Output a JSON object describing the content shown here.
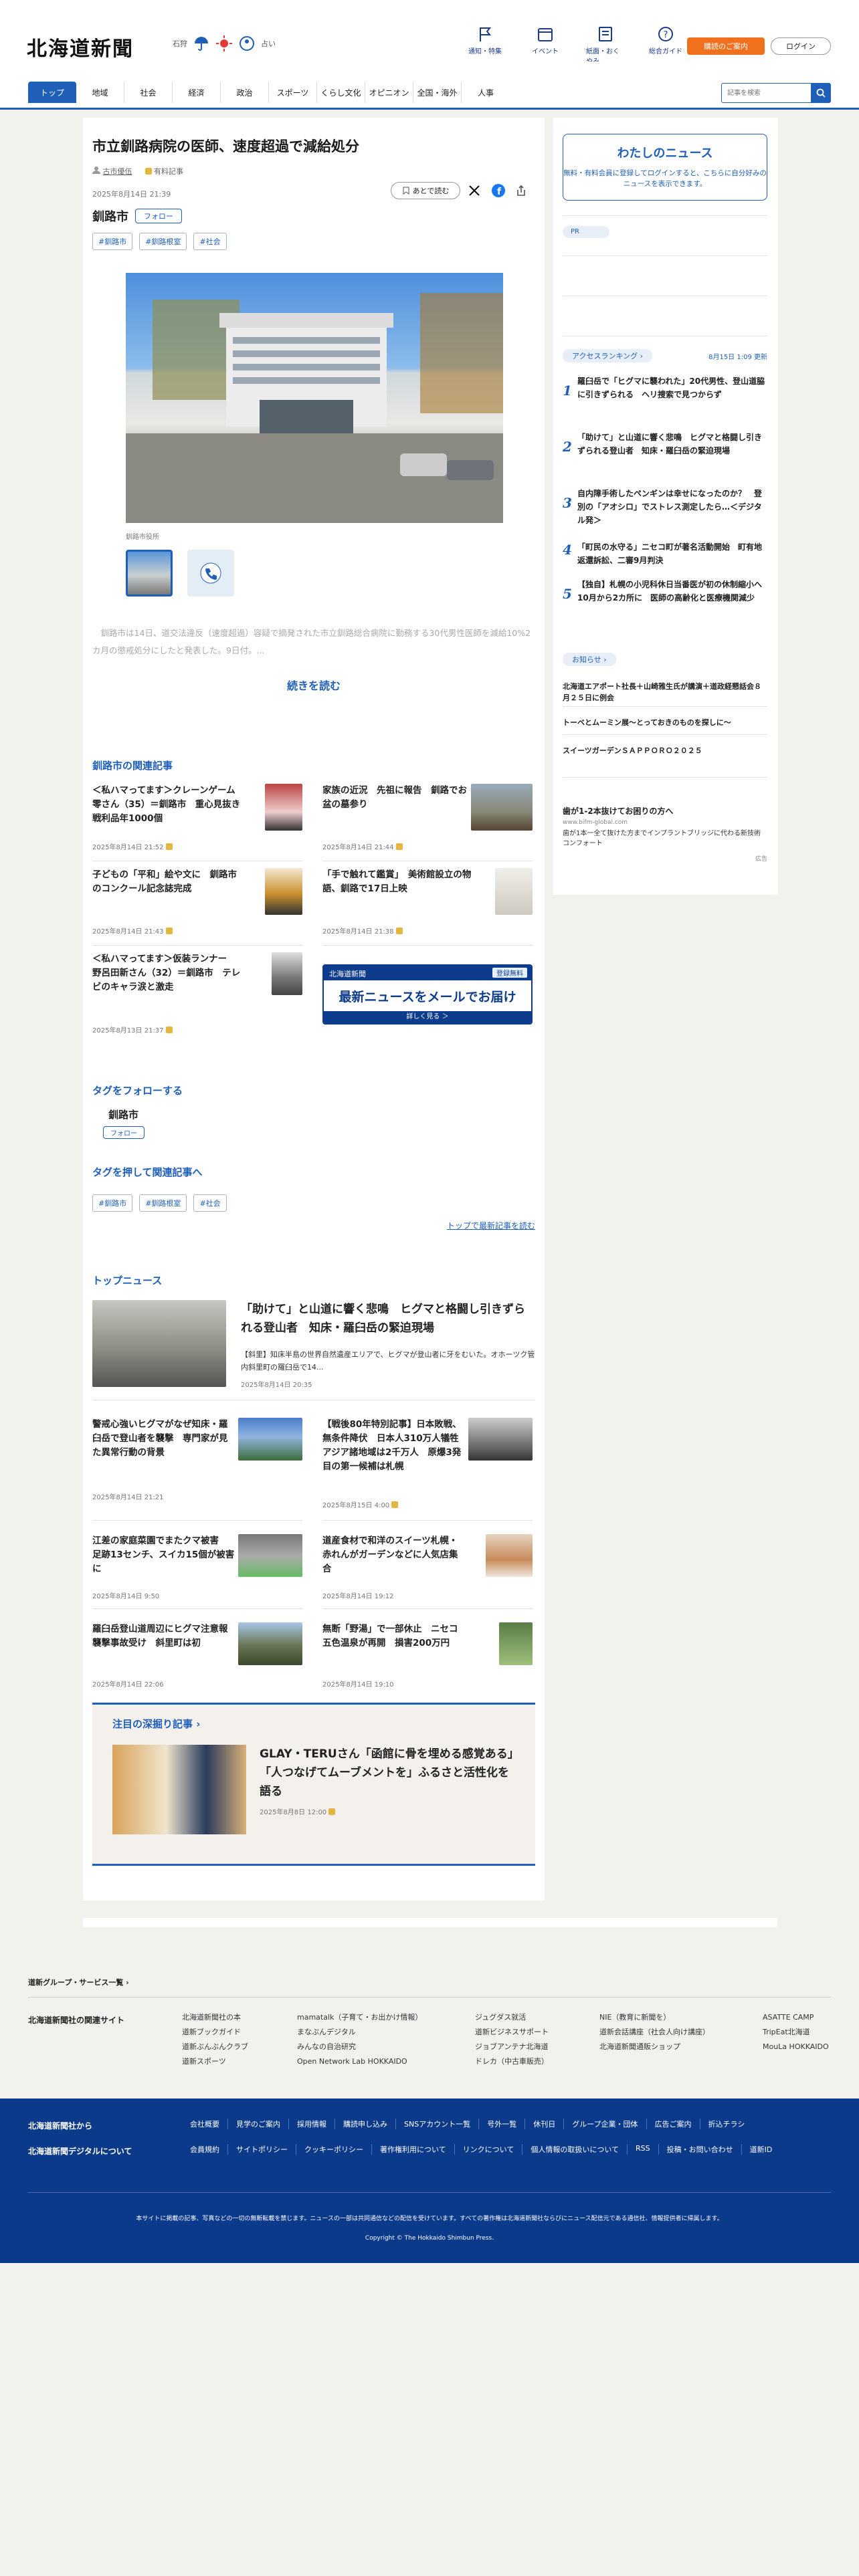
{
  "header": {
    "logo": "北海道新聞",
    "weather_city": "石狩",
    "weather_more": "占い",
    "icons": [
      "通知・特集",
      "イベント",
      "紙面・おくやみ",
      "総合ガイド"
    ],
    "member_button": "購読のご案内",
    "login_button": "ログイン"
  },
  "nav": {
    "items": [
      "トップ",
      "地域",
      "社会",
      "経済",
      "政治",
      "スポーツ",
      "くらし文化",
      "オピニオン",
      "全国・海外",
      "人事"
    ],
    "search_placeholder": "記事を検索"
  },
  "article": {
    "title": "市立釧路病院の医師、速度超過で減給処分",
    "author": "古市優伍",
    "member_badge": "有料記事",
    "datetime": "2025年8月14日 21:39",
    "read_later": "あとで読む",
    "tag_city": "釧路市",
    "follow_label": "フォロー",
    "tags": [
      "#釧路市",
      "#釧路根室",
      "#社会"
    ],
    "photo_caption": "釧路市役所",
    "lead": "　釧路市は14日、道交法違反（速度超過）容疑で摘発された市立釧路総合病院に勤務する30代男性医師を減給10%2カ月の懲戒処分にしたと発表した。9日付。...",
    "read_more": "続きを読む"
  },
  "related": {
    "title": "釧路市の関連記事",
    "items": [
      {
        "title": "＜私ハマってます＞クレーンゲーム　零さん（35）＝釧路市　重心見抜き　戦利品年1000個",
        "date": "2025年8月14日 21:52"
      },
      {
        "title": "家族の近況　先祖に報告　釧路でお盆の墓参り",
        "date": "2025年8月14日 21:44"
      },
      {
        "title": "子どもの「平和」絵や文に　釧路市のコンクール記念誌完成",
        "date": "2025年8月14日 21:43"
      },
      {
        "title": "「手で触れて鑑賞」　美術館設立の物語、釧路で17日上映",
        "date": "2025年8月14日 21:38"
      },
      {
        "title": "＜私ハマってます＞仮装ランナー　野呂田新さん（32）＝釧路市　テレビのキャラ涙と激走",
        "date": "2025年8月13日 21:37"
      }
    ],
    "mail_ad": {
      "brand": "北海道新聞",
      "badge": "登録無料",
      "headline": "最新ニュースをメールでお届け",
      "cta": "詳しく見る ＞"
    }
  },
  "follow_section": {
    "title": "タグをフォローする",
    "city": "釧路市",
    "button": "フォロー"
  },
  "tag_section": {
    "title": "タグを押して関連記事へ",
    "tags": [
      "#釧路市",
      "#釧路根室",
      "#社会"
    ],
    "top_link": "トップで最新記事を読む"
  },
  "top_news": {
    "title": "トップニュース",
    "main": {
      "title": "「助けて」と山道に響く悲鳴　ヒグマと格闘し引きずられる登山者　知床・羅臼岳の緊迫現場",
      "summary": "【斜里】知床半島の世界自然遺産エリアで、ヒグマが登山者に牙をむいた。オホーツク管内斜里町の羅臼岳で14...",
      "date": "2025年8月14日 20:35"
    },
    "items": [
      {
        "title": "警戒心強いヒグマがなぜ知床・羅臼岳で登山者を襲撃　専門家が見た異常行動の背景",
        "date": "2025年8月14日 21:21"
      },
      {
        "title": "【戦後80年特別記事】日本敗戦、無条件降伏　日本人310万人犠牲　アジア諸地域は2千万人　原爆3発目の第一候補は札幌",
        "date": "2025年8月15日 4:00"
      },
      {
        "title": "江差の家庭菜園でまたクマ被害　足跡13センチ、スイカ15個が被害に",
        "date": "2025年8月14日 9:50"
      },
      {
        "title": "道産食材で和洋のスイーツ札幌・赤れんがガーデンなどに人気店集合",
        "date": "2025年8月14日 19:12"
      },
      {
        "title": "羅臼岳登山道周辺にヒグマ注意報　襲撃事故受け　斜里町は初",
        "date": "2025年8月14日 22:06"
      },
      {
        "title": "無断「野湯」で一部休止　ニセコ五色温泉が再開　損害200万円",
        "date": "2025年8月14日 19:10"
      }
    ]
  },
  "feature": {
    "title": "注目の深掘り記事",
    "headline": "GLAY・TERUさん「函館に骨を埋める感覚ある」「人つなげてムーブメントを」ふるさと活性化を語る",
    "date": "2025年8月8日 12:00"
  },
  "sidebar": {
    "mynews_title": "わたしのニュース",
    "mynews_text": "無料・有料会員に登録してログインすると、こちらに自分好みのニュースを表示できます。",
    "pr": "PR",
    "ranking_title": "アクセスランキング",
    "ranking_updated": "8月15日 1:09 更新",
    "ranking": [
      "羅臼岳で「ヒグマに襲われた」20代男性、登山道脇に引きずられる　ヘリ捜索で見つからず",
      "「助けて」と山道に響く悲鳴　ヒグマと格闘し引きずられる登山者　知床・羅臼岳の緊迫現場",
      "自内障手術したペンギンは幸せになったのか？　登別の「アオシロ」でストレス測定したら…＜デジタル発＞",
      "「町民の水守る」ニセコ町が著名活動開始　町有地返還訴訟、二審9月判決",
      "【独自】札幌の小児科休日当番医が初の休制縮小へ　10月から2カ所に　医師の高齢化と医療機関減少"
    ],
    "info_title": "お知らせ",
    "info": [
      "北海道エアポート社長＋山崎雅生氏が講演＋道政経懇話会８月２５日に例会",
      "トーベとムーミン展～とっておきのものを探しに～",
      "スイーツガーデンＳＡＰＰＯＲＯ２０２５"
    ],
    "ad_title": "歯が1-2本抜けてお困りの方へ",
    "ad_url": "www.bifm-global.com",
    "ad_text": "歯が1本一全て抜けた方までインプラントブリッジに代わる新技術コンフォート",
    "ad_label": "広告"
  },
  "footer": {
    "group_link": "道新グループ・サービス一覧",
    "related_title": "北海道新聞社の関連サイト",
    "cols": [
      [
        "北海道新聞社の本",
        "道新ブックガイド",
        "道新ぶんぶんクラブ",
        "道新スポーツ"
      ],
      [
        "mamatalk（子育て・お出かけ情報）",
        "まなぶんデジタル",
        "みんなの自治研究",
        "Open Network Lab HOKKAIDO"
      ],
      [
        "ジュグダス就活",
        "道新ビジネスサポート",
        "ジョブアンテナ北海道",
        "ドレカ（中古車販売）"
      ],
      [
        "NIE（教育に新聞を）",
        "道新会話講座（社会人向け講座）",
        "北海道新聞通販ショップ"
      ],
      [
        "ASATTE CAMP",
        "TripEat北海道",
        "MouLa HOKKAIDO"
      ]
    ],
    "dark_title1": "北海道新聞社から",
    "dark_title2": "北海道新聞デジタルについて",
    "row1": [
      "会社概要",
      "見学のご案内",
      "採用情報",
      "購読申し込み",
      "SNSアカウント一覧",
      "号外一覧",
      "休刊日",
      "グループ企業・団体",
      "広告ご案内",
      "折込チラシ"
    ],
    "row2": [
      "会員規約",
      "サイトポリシー",
      "クッキーポリシー",
      "著作権利用について",
      "リンクについて",
      "個人情報の取扱いについて",
      "RSS",
      "投稿・お問い合わせ",
      "道新ID"
    ],
    "notice": "本サイトに掲載の記事、写真などの一切の無断転載を禁じます。ニュースの一部は共同通信などの配信を受けています。すべての著作権は北海道新聞社ならびにニュース配信元である通信社、情報提供者に帰属します。",
    "copyright": "Copyright © The Hokkaido Shimbun Press."
  }
}
